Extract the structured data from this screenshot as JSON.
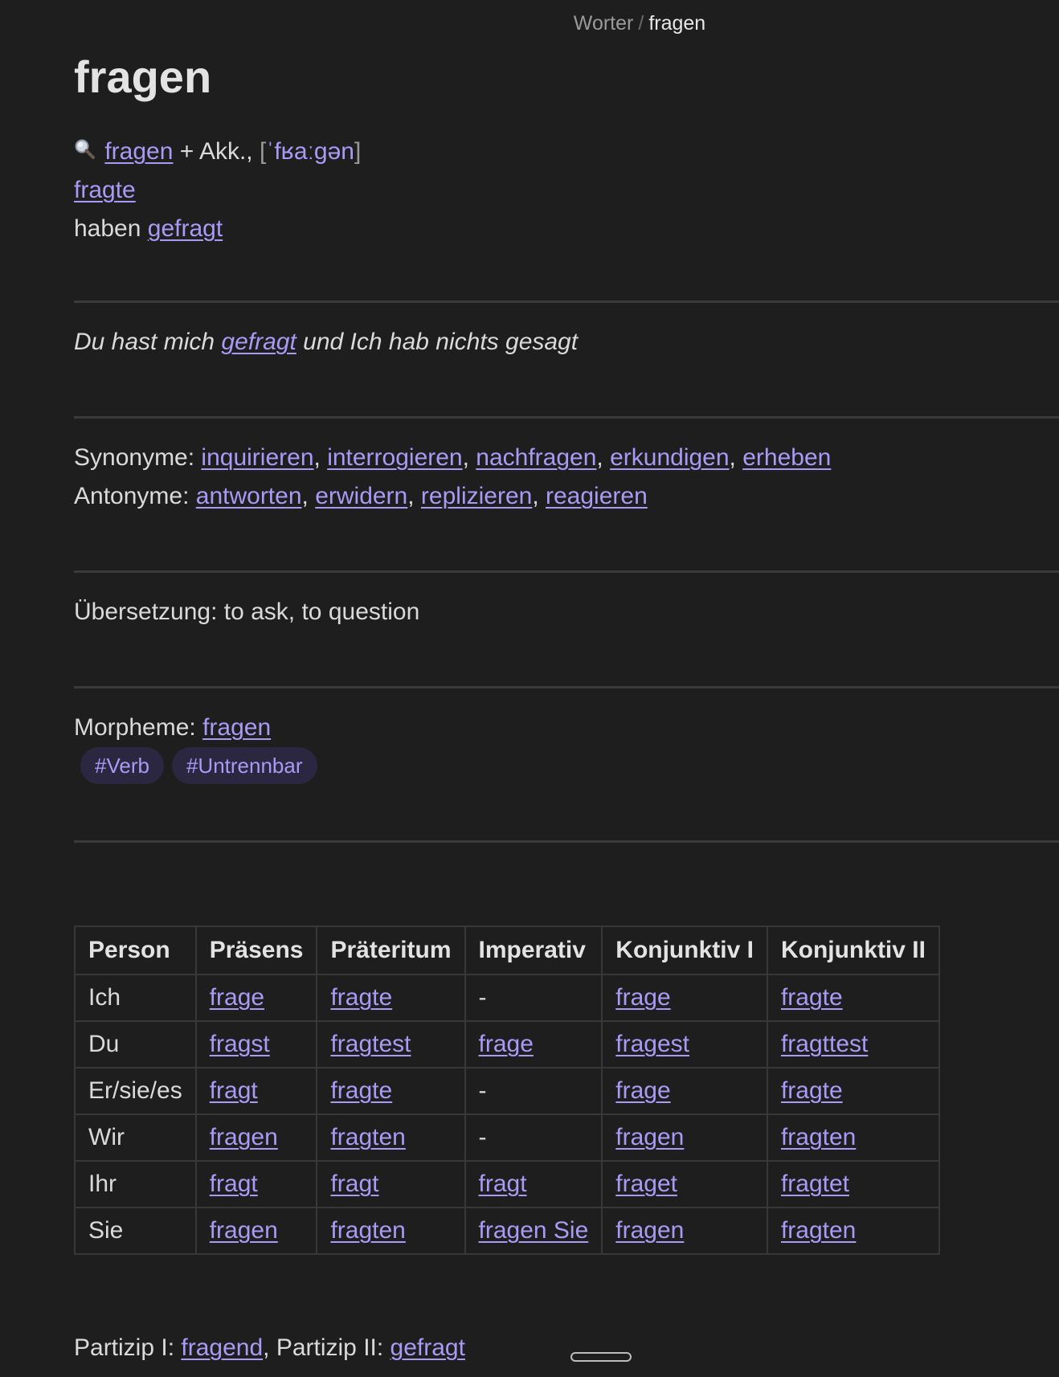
{
  "breadcrumb": {
    "parent": "Worter",
    "separator": "/",
    "current": "fragen"
  },
  "title": "fragen",
  "header": {
    "search_icon": "magnifier-icon",
    "infinitive_link": "fragen",
    "case_text": "+ Akk.,",
    "ipa_open": "[",
    "ipa": "ˈfʁaːɡən",
    "ipa_close": "]",
    "preterite_link": "fragte",
    "perfect_aux": "haben",
    "perfect_link": "gefragt"
  },
  "example": {
    "before": "Du hast mich",
    "link": "gefragt",
    "after": "und Ich hab nichts gesagt"
  },
  "synonyms": {
    "label": "Synonyme:",
    "items": [
      "inquirieren",
      "interrogieren",
      "nachfragen",
      "erkundigen",
      "erheben"
    ]
  },
  "antonyms": {
    "label": "Antonyme:",
    "items": [
      "antworten",
      "erwidern",
      "replizieren",
      "reagieren"
    ]
  },
  "translation": "Übersetzung: to ask, to question",
  "morpheme": {
    "label": "Morpheme:",
    "link": "fragen"
  },
  "tags": [
    "#Verb",
    "#Untrennbar"
  ],
  "table": {
    "headers": [
      "Person",
      "Präsens",
      "Präteritum",
      "Imperativ",
      "Konjunktiv I",
      "Konjunktiv II"
    ],
    "rows": [
      [
        "Ich",
        "frage",
        "fragte",
        "-",
        "frage",
        "fragte"
      ],
      [
        "Du",
        "fragst",
        "fragtest",
        "frage",
        "fragest",
        "fragttest"
      ],
      [
        "Er/sie/es",
        "fragt",
        "fragte",
        "-",
        "frage",
        "fragte"
      ],
      [
        "Wir",
        "fragen",
        "fragten",
        "-",
        "fragen",
        "fragten"
      ],
      [
        "Ihr",
        "fragt",
        "fragt",
        "fragt",
        "fraget",
        "fragtet"
      ],
      [
        "Sie",
        "fragen",
        "fragten",
        "fragen Sie",
        "fragen",
        "fragten"
      ]
    ]
  },
  "participles": {
    "p1_label": "Partizip I:",
    "p1": "fragend",
    "sep": ",",
    "p2_label": "Partizip II:",
    "p2": "gefragt"
  }
}
